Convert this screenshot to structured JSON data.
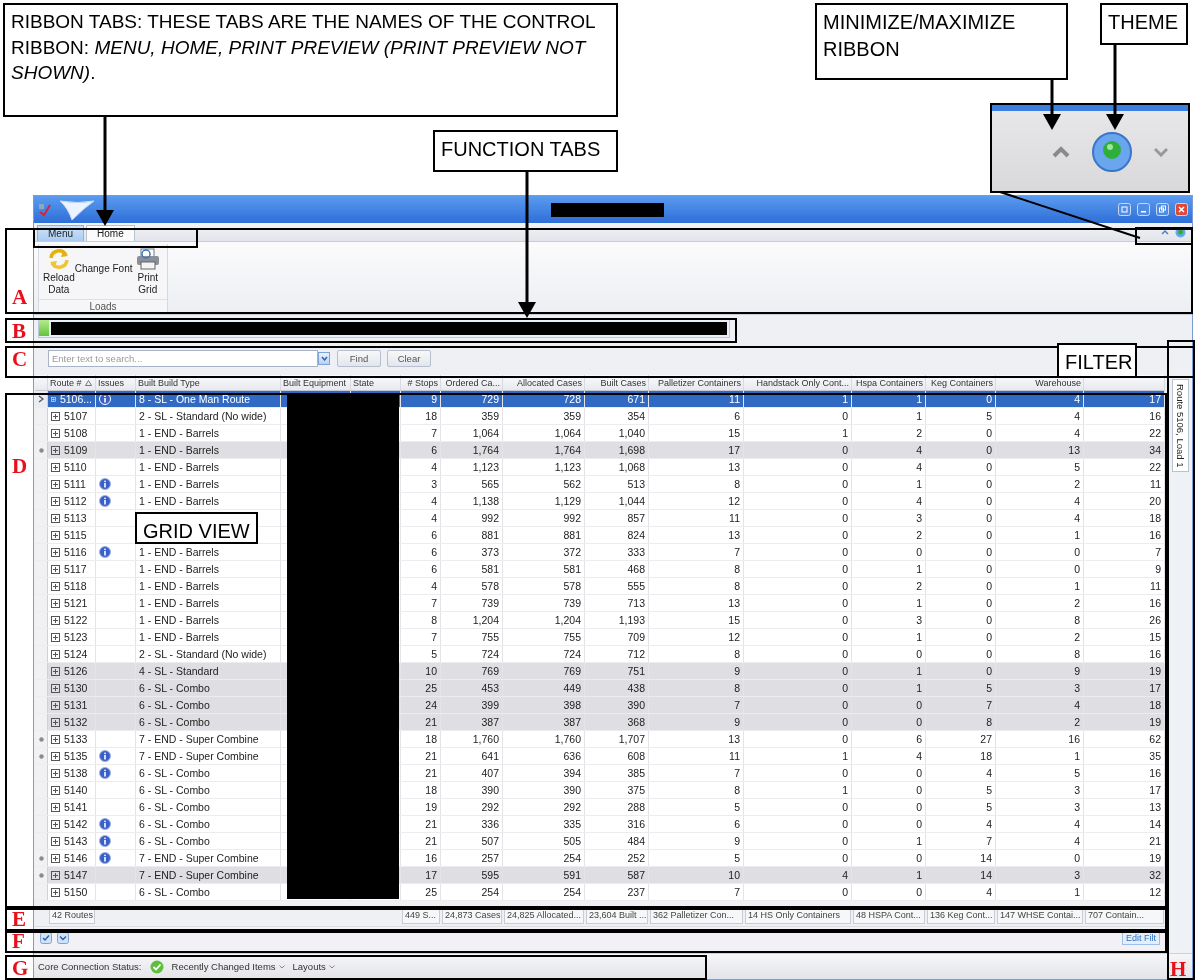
{
  "annotations": {
    "callouts": [
      {
        "kind": "ribbon-tabs",
        "text": "RIBBON TABS: THESE TABS ARE THE NAMES OF THE CONTROL RIBBON: *MENU, HOME, PRINT PREVIEW* *(PRINT PREVIEW NOT SHOWN)*."
      },
      {
        "kind": "function-tabs",
        "text": "FUNCTION TABS"
      },
      {
        "kind": "minimize-ribbon",
        "text": "MINIMIZE/MAXIMIZE RIBBON"
      },
      {
        "kind": "theme",
        "text": "THEME"
      },
      {
        "kind": "filter",
        "text": "FILTER"
      },
      {
        "kind": "grid-view",
        "text": "GRID VIEW"
      }
    ],
    "regions": [
      "A",
      "B",
      "C",
      "D",
      "E",
      "F",
      "G",
      "H"
    ]
  },
  "window": {
    "ribbon_tabs": [
      {
        "label": "Menu",
        "kind": "app-menu",
        "selected": false
      },
      {
        "label": "Home",
        "kind": "tab",
        "selected": true
      }
    ],
    "ribbon_group": {
      "label": "Loads",
      "buttons": [
        {
          "kind": "reload",
          "label": "Reload Data"
        },
        {
          "kind": "text",
          "label": "Change Font"
        },
        {
          "kind": "print",
          "label": "Print Grid"
        }
      ]
    }
  },
  "search": {
    "placeholder": "Enter text to search...",
    "buttons": [
      "Find",
      "Clear"
    ]
  },
  "grid": {
    "columns": [
      {
        "label": "Route #",
        "kind": "route",
        "sorted": true
      },
      {
        "label": "Issues",
        "kind": "issues",
        "sorted": false
      },
      {
        "label": "Built Build Type",
        "kind": "text",
        "sorted": false
      },
      {
        "label": "Built Equipment",
        "kind": "redacted",
        "sorted": false
      },
      {
        "label": "State",
        "kind": "redacted",
        "sorted": false
      },
      {
        "label": "# Stops",
        "kind": "number",
        "sorted": false
      },
      {
        "label": "Ordered Ca...",
        "kind": "number",
        "sorted": false
      },
      {
        "label": "Allocated Cases",
        "kind": "number",
        "sorted": false
      },
      {
        "label": "Built Cases",
        "kind": "number",
        "sorted": false
      },
      {
        "label": "Palletizer Containers",
        "kind": "number",
        "sorted": false
      },
      {
        "label": "Handstack Only Cont...",
        "kind": "number",
        "sorted": false
      },
      {
        "label": "Hspa Containers",
        "kind": "number",
        "sorted": false
      },
      {
        "label": "Keg Containers",
        "kind": "number",
        "sorted": false
      },
      {
        "label": "Warehouse",
        "kind": "number",
        "sorted": false
      },
      {
        "kind": "number",
        "sorted": false
      }
    ],
    "rows": [
      {
        "selected": true,
        "shaded": false,
        "flagged": false,
        "has_issue": true,
        "cells": [
          "5106...",
          "",
          "8 - SL - One Man Route",
          "",
          "",
          "9",
          "729",
          "728",
          "671",
          "11",
          "1",
          "1",
          "0",
          "4",
          "17"
        ]
      },
      {
        "selected": false,
        "shaded": false,
        "flagged": false,
        "has_issue": false,
        "cells": [
          "5107",
          "",
          "2 - SL - Standard (No wide)",
          "",
          "",
          "18",
          "359",
          "359",
          "354",
          "6",
          "0",
          "1",
          "5",
          "4",
          "16"
        ]
      },
      {
        "selected": false,
        "shaded": false,
        "flagged": false,
        "has_issue": false,
        "cells": [
          "5108",
          "",
          "1 - END - Barrels",
          "",
          "",
          "7",
          "1,064",
          "1,064",
          "1,040",
          "15",
          "1",
          "2",
          "0",
          "4",
          "22"
        ]
      },
      {
        "selected": false,
        "shaded": true,
        "flagged": true,
        "has_issue": false,
        "cells": [
          "5109",
          "",
          "1 - END - Barrels",
          "",
          "",
          "6",
          "1,764",
          "1,764",
          "1,698",
          "17",
          "0",
          "4",
          "0",
          "13",
          "34"
        ]
      },
      {
        "selected": false,
        "shaded": false,
        "flagged": false,
        "has_issue": false,
        "cells": [
          "5110",
          "",
          "1 - END - Barrels",
          "",
          "",
          "4",
          "1,123",
          "1,123",
          "1,068",
          "13",
          "0",
          "4",
          "0",
          "5",
          "22"
        ]
      },
      {
        "selected": false,
        "shaded": false,
        "flagged": false,
        "has_issue": true,
        "cells": [
          "5111",
          "",
          "1 - END - Barrels",
          "",
          "",
          "3",
          "565",
          "562",
          "513",
          "8",
          "0",
          "1",
          "0",
          "2",
          "11"
        ]
      },
      {
        "selected": false,
        "shaded": false,
        "flagged": false,
        "has_issue": true,
        "cells": [
          "5112",
          "",
          "1 - END - Barrels",
          "",
          "",
          "4",
          "1,138",
          "1,129",
          "1,044",
          "12",
          "0",
          "4",
          "0",
          "4",
          "20"
        ]
      },
      {
        "selected": false,
        "shaded": false,
        "flagged": false,
        "has_issue": false,
        "cells": [
          "5113",
          "",
          "",
          "",
          "",
          "4",
          "992",
          "992",
          "857",
          "11",
          "0",
          "3",
          "0",
          "4",
          "18"
        ]
      },
      {
        "selected": false,
        "shaded": false,
        "flagged": false,
        "has_issue": false,
        "cells": [
          "5115",
          "",
          "",
          "",
          "",
          "6",
          "881",
          "881",
          "824",
          "13",
          "0",
          "2",
          "0",
          "1",
          "16"
        ]
      },
      {
        "selected": false,
        "shaded": false,
        "flagged": false,
        "has_issue": true,
        "cells": [
          "5116",
          "",
          "1 - END - Barrels",
          "",
          "",
          "6",
          "373",
          "372",
          "333",
          "7",
          "0",
          "0",
          "0",
          "0",
          "7"
        ]
      },
      {
        "selected": false,
        "shaded": false,
        "flagged": false,
        "has_issue": false,
        "cells": [
          "5117",
          "",
          "1 - END - Barrels",
          "",
          "",
          "6",
          "581",
          "581",
          "468",
          "8",
          "0",
          "1",
          "0",
          "0",
          "9"
        ]
      },
      {
        "selected": false,
        "shaded": false,
        "flagged": false,
        "has_issue": false,
        "cells": [
          "5118",
          "",
          "1 - END - Barrels",
          "",
          "",
          "4",
          "578",
          "578",
          "555",
          "8",
          "0",
          "2",
          "0",
          "1",
          "11"
        ]
      },
      {
        "selected": false,
        "shaded": false,
        "flagged": false,
        "has_issue": false,
        "cells": [
          "5121",
          "",
          "1 - END - Barrels",
          "",
          "",
          "7",
          "739",
          "739",
          "713",
          "13",
          "0",
          "1",
          "0",
          "2",
          "16"
        ]
      },
      {
        "selected": false,
        "shaded": false,
        "flagged": false,
        "has_issue": false,
        "cells": [
          "5122",
          "",
          "1 - END - Barrels",
          "",
          "",
          "8",
          "1,204",
          "1,204",
          "1,193",
          "15",
          "0",
          "3",
          "0",
          "8",
          "26"
        ]
      },
      {
        "selected": false,
        "shaded": false,
        "flagged": false,
        "has_issue": false,
        "cells": [
          "5123",
          "",
          "1 - END - Barrels",
          "",
          "",
          "7",
          "755",
          "755",
          "709",
          "12",
          "0",
          "1",
          "0",
          "2",
          "15"
        ]
      },
      {
        "selected": false,
        "shaded": false,
        "flagged": false,
        "has_issue": false,
        "cells": [
          "5124",
          "",
          "2 - SL - Standard (No wide)",
          "",
          "",
          "5",
          "724",
          "724",
          "712",
          "8",
          "0",
          "0",
          "0",
          "8",
          "16"
        ]
      },
      {
        "selected": false,
        "shaded": true,
        "flagged": false,
        "has_issue": false,
        "cells": [
          "5126",
          "",
          "4 - SL - Standard",
          "",
          "",
          "10",
          "769",
          "769",
          "751",
          "9",
          "0",
          "1",
          "0",
          "9",
          "19"
        ]
      },
      {
        "selected": false,
        "shaded": true,
        "flagged": false,
        "has_issue": false,
        "cells": [
          "5130",
          "",
          "6 - SL - Combo",
          "",
          "",
          "25",
          "453",
          "449",
          "438",
          "8",
          "0",
          "1",
          "5",
          "3",
          "17"
        ]
      },
      {
        "selected": false,
        "shaded": true,
        "flagged": false,
        "has_issue": false,
        "cells": [
          "5131",
          "",
          "6 - SL - Combo",
          "",
          "",
          "24",
          "399",
          "398",
          "390",
          "7",
          "0",
          "0",
          "7",
          "4",
          "18"
        ]
      },
      {
        "selected": false,
        "shaded": true,
        "flagged": false,
        "has_issue": false,
        "cells": [
          "5132",
          "",
          "6 - SL - Combo",
          "",
          "",
          "21",
          "387",
          "387",
          "368",
          "9",
          "0",
          "0",
          "8",
          "2",
          "19"
        ]
      },
      {
        "selected": false,
        "shaded": false,
        "flagged": true,
        "has_issue": false,
        "cells": [
          "5133",
          "",
          "7 - END - Super Combine",
          "",
          "",
          "18",
          "1,760",
          "1,760",
          "1,707",
          "13",
          "0",
          "6",
          "27",
          "16",
          "62"
        ]
      },
      {
        "selected": false,
        "shaded": false,
        "flagged": true,
        "has_issue": true,
        "cells": [
          "5135",
          "",
          "7 - END - Super Combine",
          "",
          "",
          "21",
          "641",
          "636",
          "608",
          "11",
          "1",
          "4",
          "18",
          "1",
          "35"
        ]
      },
      {
        "selected": false,
        "shaded": false,
        "flagged": false,
        "has_issue": true,
        "cells": [
          "5138",
          "",
          "6 - SL - Combo",
          "",
          "",
          "21",
          "407",
          "394",
          "385",
          "7",
          "0",
          "0",
          "4",
          "5",
          "16"
        ]
      },
      {
        "selected": false,
        "shaded": false,
        "flagged": false,
        "has_issue": false,
        "cells": [
          "5140",
          "",
          "6 - SL - Combo",
          "",
          "",
          "18",
          "390",
          "390",
          "375",
          "8",
          "1",
          "0",
          "5",
          "3",
          "17"
        ]
      },
      {
        "selected": false,
        "shaded": false,
        "flagged": false,
        "has_issue": false,
        "cells": [
          "5141",
          "",
          "6 - SL - Combo",
          "",
          "",
          "19",
          "292",
          "292",
          "288",
          "5",
          "0",
          "0",
          "5",
          "3",
          "13"
        ]
      },
      {
        "selected": false,
        "shaded": false,
        "flagged": false,
        "has_issue": true,
        "cells": [
          "5142",
          "",
          "6 - SL - Combo",
          "",
          "",
          "21",
          "336",
          "335",
          "316",
          "6",
          "0",
          "0",
          "4",
          "4",
          "14"
        ]
      },
      {
        "selected": false,
        "shaded": false,
        "flagged": false,
        "has_issue": true,
        "cells": [
          "5143",
          "",
          "6 - SL - Combo",
          "",
          "",
          "21",
          "507",
          "505",
          "484",
          "9",
          "0",
          "1",
          "7",
          "4",
          "21"
        ]
      },
      {
        "selected": false,
        "shaded": false,
        "flagged": true,
        "has_issue": true,
        "cells": [
          "5146",
          "",
          "7 - END - Super Combine",
          "",
          "",
          "16",
          "257",
          "254",
          "252",
          "5",
          "0",
          "0",
          "14",
          "0",
          "19"
        ]
      },
      {
        "selected": false,
        "shaded": true,
        "flagged": true,
        "has_issue": false,
        "cells": [
          "5147",
          "",
          "7 - END - Super Combine",
          "",
          "",
          "17",
          "595",
          "591",
          "587",
          "10",
          "4",
          "1",
          "14",
          "3",
          "32"
        ]
      },
      {
        "selected": false,
        "shaded": false,
        "flagged": false,
        "has_issue": false,
        "cells": [
          "5150",
          "",
          "6 - SL - Combo",
          "",
          "",
          "25",
          "254",
          "254",
          "237",
          "7",
          "0",
          "0",
          "4",
          "1",
          "12"
        ]
      }
    ],
    "summary": {
      "routes": "42 Routes",
      "totals": [
        "449 S...",
        "24,873 Cases",
        "24,825 Allocated...",
        "23,604 Built ...",
        "362 Palletizer Con...",
        "14 HS Only Containers",
        "48 HSPA Cont...",
        "136 Keg Cont...",
        "147 WHSE Contai...",
        "707 Contain..."
      ]
    }
  },
  "filter_bar": {
    "button": "Edit Filt"
  },
  "side_tab": "Route 5106, Load 1",
  "status_bar": {
    "label": "Core Connection Status:",
    "connected": true,
    "menus": [
      "Recently Changed Items",
      "Layouts"
    ]
  }
}
